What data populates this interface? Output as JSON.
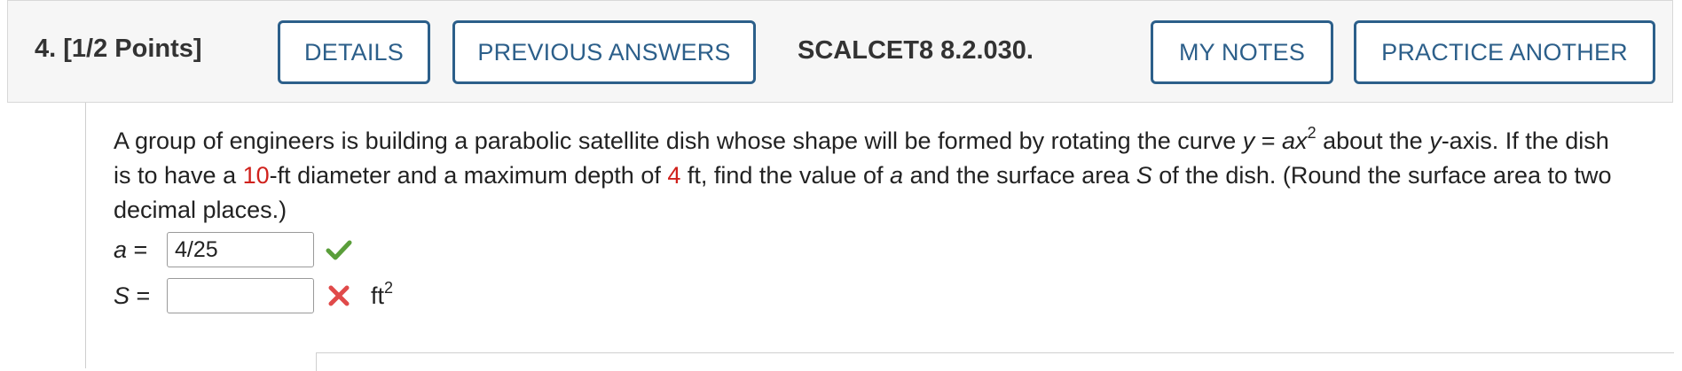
{
  "header": {
    "question_label": "4. [1/2 Points]",
    "buttons": {
      "details": "DETAILS",
      "previous_answers": "PREVIOUS ANSWERS",
      "my_notes": "MY NOTES",
      "practice_another": "PRACTICE ANOTHER"
    },
    "reference": "SCALCET8 8.2.030."
  },
  "problem": {
    "t1": "A group of engineers is building a parabolic satellite dish whose shape will be formed by rotating the curve ",
    "curve_y": "y",
    "equals": " = ",
    "curve_rhs": "ax",
    "exponent": "2",
    "t2": " about the ",
    "axis_var": "y",
    "t3": "-axis. If the dish is to have a ",
    "diameter": "10",
    "t4": "-ft diameter and a maximum depth of ",
    "depth": "4",
    "t5": " ft, find the value of ",
    "var_a": "a",
    "t6": " and the surface area ",
    "var_S": "S",
    "t7": " of the dish. (Round the surface area to two decimal places.)"
  },
  "answers": {
    "a_label_var": "a",
    "a_label_eq": " =",
    "a_value": "4/25",
    "a_status": "correct",
    "S_label_var": "S",
    "S_label_eq": " =",
    "S_value": "",
    "S_status": "incorrect",
    "S_unit": "ft",
    "S_unit_exp": "2"
  },
  "colors": {
    "button_border": "#2c5f8a",
    "highlight_red": "#d0211c",
    "check_green": "#5a9e3a",
    "cross_red": "#e04a4a"
  }
}
